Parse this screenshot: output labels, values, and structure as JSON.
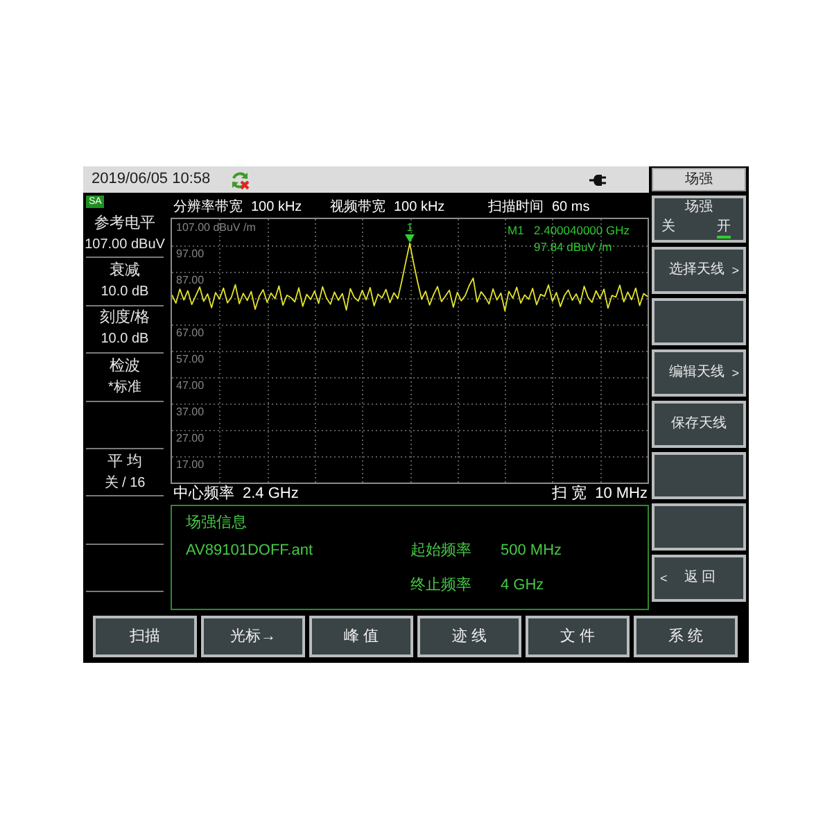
{
  "status_bar": {
    "datetime": "2019/06/05 10:58"
  },
  "mode_badge": "SA",
  "left_panel": [
    {
      "kind": "setting",
      "label": "参考电平",
      "value": "107.00 dBuV"
    },
    {
      "kind": "setting",
      "label": "衰减",
      "value": "10.0 dB"
    },
    {
      "kind": "setting",
      "label": "刻度/格",
      "value": "10.0 dB"
    },
    {
      "kind": "setting",
      "label": "检波",
      "value": "*标准"
    },
    {
      "kind": "blank"
    },
    {
      "kind": "setting",
      "label": "平 均",
      "value": "关 / 16"
    },
    {
      "kind": "blank"
    },
    {
      "kind": "blank"
    }
  ],
  "header": [
    {
      "label": "分辨率带宽",
      "value": "100 kHz"
    },
    {
      "label": "视频带宽",
      "value": "100 kHz"
    },
    {
      "label": "扫描时间",
      "value": "60 ms"
    }
  ],
  "plot": {
    "chart_data": {
      "type": "line",
      "grid": true,
      "ylim": [
        7,
        107
      ],
      "yticks": [
        {
          "value": 107,
          "label": "107.00 dBuV /m"
        },
        {
          "value": 97,
          "label": "97.00"
        },
        {
          "value": 87,
          "label": "87.00"
        },
        {
          "value": 67,
          "label": "67.00"
        },
        {
          "value": 57,
          "label": "57.00"
        },
        {
          "value": 47,
          "label": "47.00"
        },
        {
          "value": 37,
          "label": "37.00"
        },
        {
          "value": 27,
          "label": "27.00"
        },
        {
          "value": 17,
          "label": "17.00"
        }
      ],
      "series": [
        {
          "color": "#e4e42a",
          "values": [
            78.2,
            75.1,
            80.4,
            76.3,
            79.8,
            74.6,
            77.9,
            81.2,
            75.8,
            78.6,
            73.4,
            79.1,
            76.7,
            80.8,
            75.2,
            77.4,
            82.1,
            74.9,
            78.8,
            76.1,
            79.5,
            72.8,
            77.6,
            80.2,
            75.4,
            78.9,
            76.8,
            81.6,
            74.3,
            78.1,
            77.2,
            75.6,
            80.9,
            73.9,
            78.4,
            76.5,
            79.7,
            75.0,
            81.3,
            77.0,
            74.7,
            79.3,
            76.2,
            78.7,
            72.5,
            80.6,
            77.3,
            75.9,
            79.9,
            76.4,
            81.0,
            74.1,
            78.5,
            77.1,
            80.3,
            75.3,
            79.0,
            76.9,
            83.5,
            90.8,
            97.8,
            90.1,
            83.0,
            76.6,
            79.6,
            74.4,
            78.3,
            81.4,
            75.7,
            77.8,
            80.0,
            73.6,
            79.2,
            76.0,
            78.0,
            81.8,
            84.6,
            75.5,
            79.4,
            77.5,
            74.8,
            80.5,
            76.3,
            78.9,
            72.2,
            79.6,
            77.0,
            81.1,
            75.1,
            78.2,
            76.6,
            80.7,
            74.5,
            78.4,
            77.7,
            82.0,
            75.8,
            79.1,
            73.8,
            77.9,
            80.1,
            76.2,
            78.6,
            74.9,
            81.5,
            77.2,
            75.4,
            79.8,
            76.8,
            80.4,
            73.2,
            78.0,
            77.4,
            81.9,
            75.6,
            79.3,
            76.4,
            80.8,
            74.2,
            78.7,
            77.6
          ]
        }
      ]
    },
    "marker": {
      "number": "1",
      "name": "M1",
      "frequency": "2.400040000 GHz",
      "amplitude": "97.84 dBuV /m"
    }
  },
  "footer": {
    "center": {
      "label": "中心频率",
      "value": "2.4 GHz"
    },
    "span": {
      "label": "扫 宽",
      "value": "10 MHz"
    }
  },
  "info_panel": {
    "title": "场强信息",
    "file": "AV89101DOFF.ant",
    "fields": [
      {
        "label": "起始频率",
        "value": "500 MHz"
      },
      {
        "label": "终止频率",
        "value": "4 GHz"
      }
    ]
  },
  "softkeys": {
    "title": "场强",
    "keys": [
      {
        "kind": "toggle",
        "label": "场强",
        "options": [
          {
            "label": "关",
            "selected": false
          },
          {
            "label": "开",
            "selected": true
          }
        ]
      },
      {
        "kind": "submenu",
        "label": "选择天线",
        "arrow": ">"
      },
      {
        "kind": "blank"
      },
      {
        "kind": "submenu",
        "label": "编辑天线",
        "arrow": ">"
      },
      {
        "kind": "action",
        "label": "保存天线"
      },
      {
        "kind": "blank"
      },
      {
        "kind": "blank"
      },
      {
        "kind": "back",
        "arrow": "<",
        "label": "返 回"
      }
    ]
  },
  "bottom_menu": [
    "扫描",
    "光标→",
    "峰 值",
    "迹 线",
    "文 件",
    "系 统"
  ]
}
